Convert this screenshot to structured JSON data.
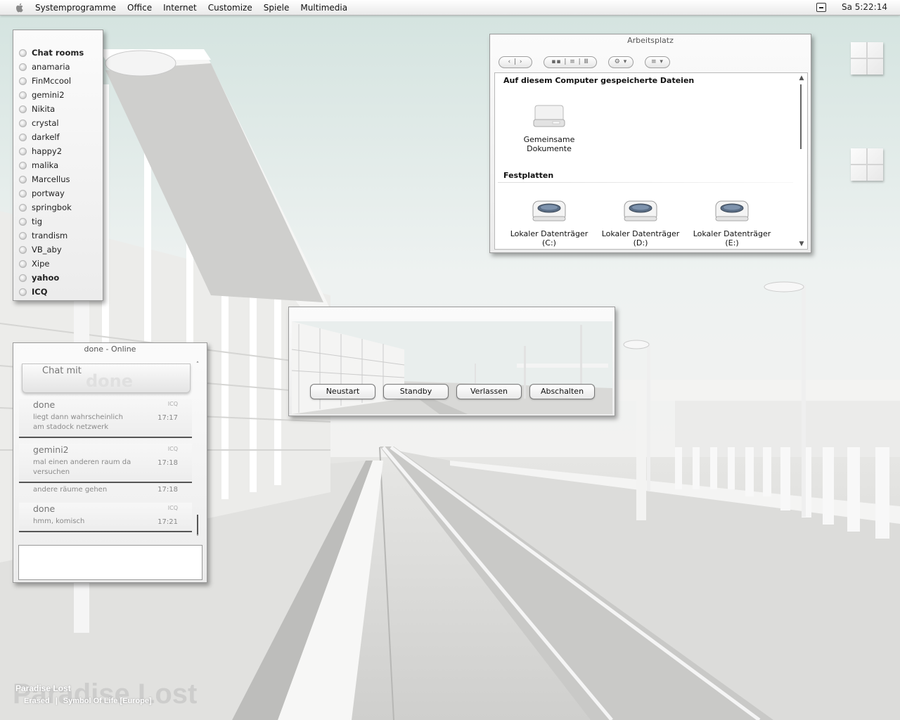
{
  "menubar": {
    "apple_icon": "apple-icon",
    "items": [
      "Systemprogramme",
      "Office",
      "Internet",
      "Customize",
      "Spiele",
      "Multimedia"
    ],
    "clock": "Sa 5:22:14"
  },
  "contacts": {
    "items": [
      {
        "label": "Chat rooms",
        "bold": true
      },
      {
        "label": "anamaria"
      },
      {
        "label": "FinMccool"
      },
      {
        "label": "gemini2"
      },
      {
        "label": "Nikita"
      },
      {
        "label": "crystal"
      },
      {
        "label": "darkelf"
      },
      {
        "label": "happy2"
      },
      {
        "label": "malika"
      },
      {
        "label": "Marcellus"
      },
      {
        "label": "portway"
      },
      {
        "label": "springbok"
      },
      {
        "label": "tig"
      },
      {
        "label": "trandism"
      },
      {
        "label": "VB_aby"
      },
      {
        "label": "Xipe"
      },
      {
        "label": "yahoo",
        "bold": true
      },
      {
        "label": "ICQ",
        "bold": true
      }
    ]
  },
  "explorer": {
    "title": "Arbeitsplatz",
    "section_files": "Auf diesem Computer gespeicherte Dateien",
    "shared_docs": "Gemeinsame Dokumente",
    "section_drives": "Festplatten",
    "drives": [
      "Lokaler Datenträger (C:)",
      "Lokaler Datenträger (D:)",
      "Lokaler Datenträger (E:)"
    ]
  },
  "chat": {
    "title": "done - Online",
    "header_label": "Chat mit",
    "header_name": "done",
    "messages": [
      {
        "name": "done",
        "protocol": "ICQ",
        "text": "liegt dann wahrscheinlich am stadock netzwerk",
        "time": "17:17"
      },
      {
        "name": "gemini2",
        "protocol": "ICQ",
        "text": "mal einen anderen raum da versuchen",
        "time": "17:18"
      },
      {
        "name": "",
        "protocol": "",
        "text": "andere räume gehen",
        "time": "17:18"
      },
      {
        "name": "done",
        "protocol": "ICQ",
        "text": "hmm, komisch",
        "time": "17:21"
      }
    ]
  },
  "shutdown": {
    "buttons": [
      "Neustart",
      "Standby",
      "Verlassen",
      "Abschalten"
    ]
  },
  "now_playing": {
    "ghost": "Paradise Lost",
    "artist": "Paradise Lost",
    "track": "Erased",
    "album": "Symbol Of Life [Europe]",
    "separator": "|"
  }
}
